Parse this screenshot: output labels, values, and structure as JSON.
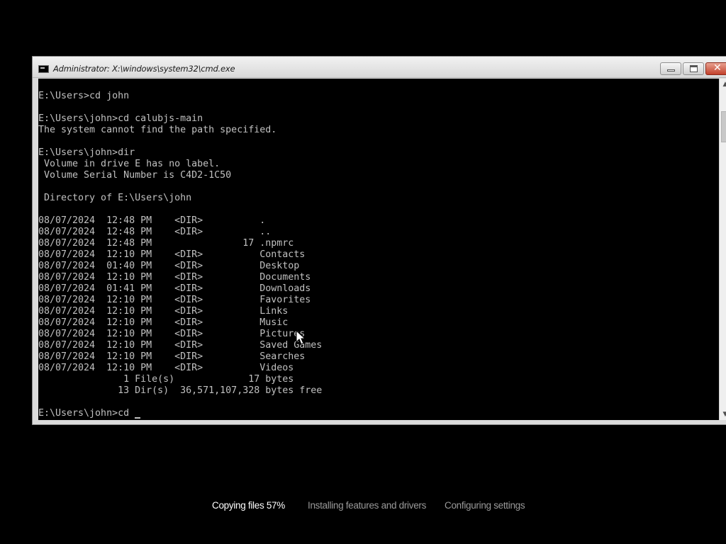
{
  "window": {
    "title": "Administrator: X:\\windows\\system32\\cmd.exe",
    "title_icon": "cmd-icon",
    "controls": {
      "minimize": "minimize-icon",
      "maximize": "maximize-icon",
      "close_glyph": "✕"
    }
  },
  "console": {
    "lines": [
      "E:\\Users>cd john",
      "",
      "E:\\Users\\john>cd calubjs-main",
      "The system cannot find the path specified.",
      "",
      "E:\\Users\\john>dir",
      " Volume in drive E has no label.",
      " Volume Serial Number is C4D2-1C50",
      "",
      " Directory of E:\\Users\\john",
      "",
      "08/07/2024  12:48 PM    <DIR>          .",
      "08/07/2024  12:48 PM    <DIR>          ..",
      "08/07/2024  12:48 PM                17 .npmrc",
      "08/07/2024  12:10 PM    <DIR>          Contacts",
      "08/07/2024  01:40 PM    <DIR>          Desktop",
      "08/07/2024  12:10 PM    <DIR>          Documents",
      "08/07/2024  01:41 PM    <DIR>          Downloads",
      "08/07/2024  12:10 PM    <DIR>          Favorites",
      "08/07/2024  12:10 PM    <DIR>          Links",
      "08/07/2024  12:10 PM    <DIR>          Music",
      "08/07/2024  12:10 PM    <DIR>          Pictures",
      "08/07/2024  12:10 PM    <DIR>          Saved Games",
      "08/07/2024  12:10 PM    <DIR>          Searches",
      "08/07/2024  12:10 PM    <DIR>          Videos",
      "               1 File(s)             17 bytes",
      "              13 Dir(s)  36,571,107,328 bytes free",
      "",
      "E:\\Users\\john>cd "
    ],
    "text_color": "#c0c0c0",
    "background": "#000000"
  },
  "scrollbar": {
    "up_glyph": "▲",
    "down_glyph": "▼"
  },
  "setup_progress": {
    "steps": [
      {
        "label": "Copying files 57%",
        "active": true
      },
      {
        "label": "Installing features and drivers",
        "active": false
      },
      {
        "label": "Configuring settings",
        "active": false
      }
    ],
    "active_color": "#ffffff",
    "inactive_color": "#9a9a9a"
  }
}
